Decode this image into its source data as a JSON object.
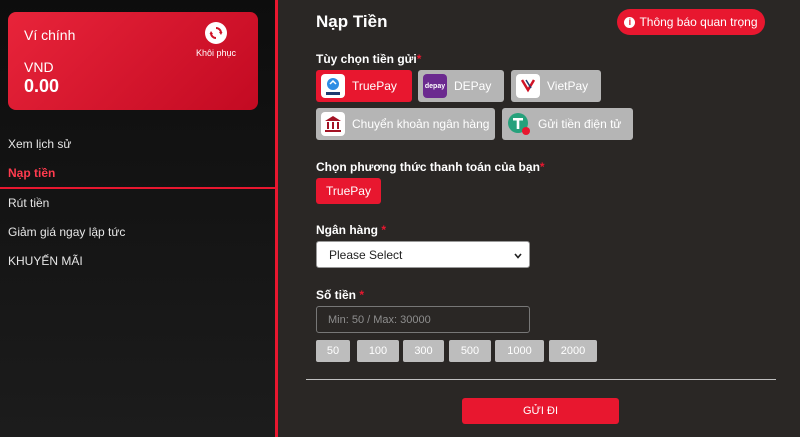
{
  "wallet": {
    "title": "Ví chính",
    "currency": "VND",
    "balance": "0.00",
    "restore_label": "Khôi phục"
  },
  "menu": {
    "items": [
      {
        "label": "Xem lịch sử"
      },
      {
        "label": "Nạp tiền"
      },
      {
        "label": "Rút tiền"
      },
      {
        "label": "Giảm giá ngay lập tức"
      },
      {
        "label": "KHUYẾN MÃI"
      }
    ]
  },
  "main": {
    "title": "Nạp Tiền",
    "notice_button": "Thông báo quan trọng",
    "deposit_options_label": "Tùy chọn tiền gửi",
    "deposit_options": [
      {
        "label": "TruePay",
        "icon_text": "TruePay"
      },
      {
        "label": "DEPay",
        "icon_text": "depay"
      },
      {
        "label": "VietPay",
        "icon_text": "VietPay"
      },
      {
        "label": "Chuyển khoản ngân hàng"
      },
      {
        "label": "Gửi tiền điện tử"
      }
    ],
    "payment_method_label": "Chọn phương thức thanh toán của bạn",
    "payment_method_button": "TruePay",
    "bank_label": "Ngân hàng",
    "bank_select_value": "Please Select",
    "amount_label": "Số tiền",
    "amount_placeholder": "Min: 50 / Max: 30000",
    "quick_amounts": [
      "50",
      "100",
      "300",
      "500",
      "1000",
      "2000"
    ],
    "submit_label": "GỬI ĐI"
  },
  "colors": {
    "accent": "#e8172f",
    "background": "#2a2725",
    "option_inactive": "#b5b5b5"
  }
}
